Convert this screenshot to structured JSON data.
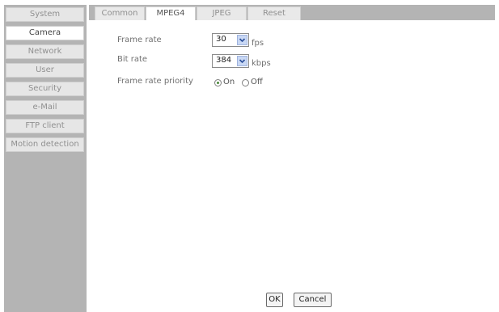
{
  "sidebar": {
    "items": [
      {
        "label": "System"
      },
      {
        "label": "Camera"
      },
      {
        "label": "Network"
      },
      {
        "label": "User"
      },
      {
        "label": "Security"
      },
      {
        "label": "e-Mail"
      },
      {
        "label": "FTP client"
      },
      {
        "label": "Motion detection"
      }
    ],
    "active": "Camera"
  },
  "tabs": [
    {
      "label": "Common"
    },
    {
      "label": "MPEG4"
    },
    {
      "label": "JPEG"
    },
    {
      "label": "Reset"
    }
  ],
  "active_tab": "MPEG4",
  "form": {
    "frame_rate": {
      "label": "Frame rate",
      "value": "30",
      "unit": "fps"
    },
    "bit_rate": {
      "label": "Bit rate",
      "value": "384",
      "unit": "kbps"
    },
    "priority": {
      "label": "Frame rate priority",
      "on_label": "On",
      "off_label": "Off",
      "selected": "On"
    }
  },
  "buttons": {
    "ok": "OK",
    "cancel": "Cancel"
  }
}
